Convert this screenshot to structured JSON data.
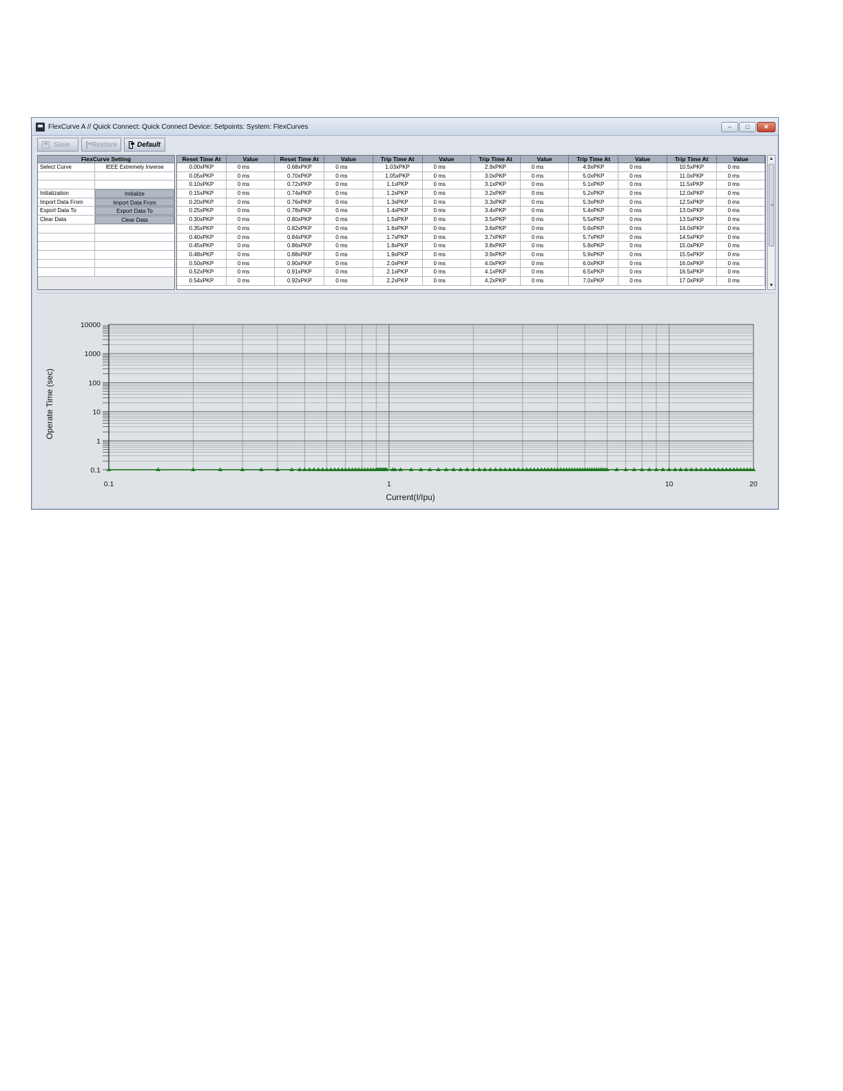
{
  "window": {
    "title": "FlexCurve A // Quick Connect: Quick Connect Device: Setpoints: System: FlexCurves",
    "controls": {
      "minimize": "–",
      "maximize": "□",
      "close": "✕"
    }
  },
  "toolbar": {
    "save_label": "Save",
    "restore_label": "Restore",
    "default_label": "Default"
  },
  "settings_panel": {
    "header": "FlexCurve Setting",
    "rows": [
      {
        "label": "Select Curve",
        "value": "IEEE Extremely Inverse",
        "is_button": false
      },
      {
        "label": "",
        "value": "",
        "is_button": false
      },
      {
        "label": "",
        "value": "",
        "is_button": false
      },
      {
        "label": "Initialization",
        "value": "Initialize",
        "is_button": true
      },
      {
        "label": "Import Data From",
        "value": "Import Data From",
        "is_button": true
      },
      {
        "label": "Export Data To",
        "value": "Export Data To",
        "is_button": true
      },
      {
        "label": "Clear Data",
        "value": "Clear Data",
        "is_button": true
      },
      {
        "label": "",
        "value": "",
        "is_button": false
      },
      {
        "label": "",
        "value": "",
        "is_button": false
      },
      {
        "label": "",
        "value": "",
        "is_button": false
      },
      {
        "label": "",
        "value": "",
        "is_button": false
      },
      {
        "label": "",
        "value": "",
        "is_button": false
      },
      {
        "label": "",
        "value": "",
        "is_button": false
      }
    ]
  },
  "curve_table": {
    "headers": [
      "Reset Time At",
      "Value",
      "Reset Time At",
      "Value",
      "Trip Time At",
      "Value",
      "Trip Time At",
      "Value",
      "Trip Time At",
      "Value",
      "Trip Time At",
      "Value"
    ],
    "columns": [
      [
        "0.00xPKP",
        "0.05xPKP",
        "0.10xPKP",
        "0.15xPKP",
        "0.20xPKP",
        "0.25xPKP",
        "0.30xPKP",
        "0.35xPKP",
        "0.40xPKP",
        "0.45xPKP",
        "0.48xPKP",
        "0.50xPKP",
        "0.52xPKP",
        "0.54xPKP"
      ],
      [
        "0.68xPKP",
        "0.70xPKP",
        "0.72xPKP",
        "0.74xPKP",
        "0.76xPKP",
        "0.78xPKP",
        "0.80xPKP",
        "0.82xPKP",
        "0.84xPKP",
        "0.86xPKP",
        "0.88xPKP",
        "0.90xPKP",
        "0.91xPKP",
        "0.92xPKP"
      ],
      [
        "1.03xPKP",
        "1.05xPKP",
        "1.1xPKP",
        "1.2xPKP",
        "1.3xPKP",
        "1.4xPKP",
        "1.5xPKP",
        "1.6xPKP",
        "1.7xPKP",
        "1.8xPKP",
        "1.9xPKP",
        "2.0xPKP",
        "2.1xPKP",
        "2.2xPKP"
      ],
      [
        "2.9xPKP",
        "3.0xPKP",
        "3.1xPKP",
        "3.2xPKP",
        "3.3xPKP",
        "3.4xPKP",
        "3.5xPKP",
        "3.6xPKP",
        "3.7xPKP",
        "3.8xPKP",
        "3.9xPKP",
        "4.0xPKP",
        "4.1xPKP",
        "4.2xPKP"
      ],
      [
        "4.9xPKP",
        "5.0xPKP",
        "5.1xPKP",
        "5.2xPKP",
        "5.3xPKP",
        "5.4xPKP",
        "5.5xPKP",
        "5.6xPKP",
        "5.7xPKP",
        "5.8xPKP",
        "5.9xPKP",
        "6.0xPKP",
        "6.5xPKP",
        "7.0xPKP"
      ],
      [
        "10.5xPKP",
        "11.0xPKP",
        "11.5xPKP",
        "12.0xPKP",
        "12.5xPKP",
        "13.0xPKP",
        "13.5xPKP",
        "14.0xPKP",
        "14.5xPKP",
        "15.0xPKP",
        "15.5xPKP",
        "16.0xPKP",
        "16.5xPKP",
        "17.0xPKP"
      ]
    ],
    "value_text": "0 ms"
  },
  "scrollbar": {
    "up": "▲",
    "down": "▼",
    "grip": "≡"
  },
  "chart_data": {
    "type": "scatter",
    "xlabel": "Current(I/Ipu)",
    "ylabel": "Operate Time (sec)",
    "x_scale": "log",
    "y_scale": "log",
    "xlim": [
      0.1,
      20
    ],
    "ylim": [
      0.1,
      10000
    ],
    "x_tick_labels": [
      "0.1",
      "1",
      "10",
      "20"
    ],
    "y_tick_labels": [
      "0.1",
      "1",
      "10",
      "100",
      "1000",
      "10000"
    ],
    "grid": true,
    "line_color": "#1a7a1a",
    "series": [
      {
        "x": [
          0.1,
          0.15,
          0.2,
          0.25,
          0.3,
          0.35,
          0.4,
          0.45,
          0.48,
          0.5,
          0.52,
          0.54,
          0.56,
          0.58,
          0.6,
          0.62,
          0.64,
          0.66,
          0.68,
          0.7,
          0.72,
          0.74,
          0.76,
          0.78,
          0.8,
          0.82,
          0.84,
          0.86,
          0.88,
          0.9,
          0.91,
          0.92,
          0.93,
          0.94,
          0.95,
          0.96,
          0.97,
          0.98,
          1.03,
          1.05,
          1.1,
          1.2,
          1.3,
          1.4,
          1.5,
          1.6,
          1.7,
          1.8,
          1.9,
          2.0,
          2.1,
          2.2,
          2.3,
          2.4,
          2.5,
          2.6,
          2.7,
          2.8,
          2.9,
          3.0,
          3.1,
          3.2,
          3.3,
          3.4,
          3.5,
          3.6,
          3.7,
          3.8,
          3.9,
          4.0,
          4.1,
          4.2,
          4.3,
          4.4,
          4.5,
          4.6,
          4.7,
          4.8,
          4.9,
          5.0,
          5.1,
          5.2,
          5.3,
          5.4,
          5.5,
          5.6,
          5.7,
          5.8,
          5.9,
          6.0,
          6.5,
          7.0,
          7.5,
          8.0,
          8.5,
          9.0,
          9.5,
          10.0,
          10.5,
          11.0,
          11.5,
          12.0,
          12.5,
          13.0,
          13.5,
          14.0,
          14.5,
          15.0,
          15.5,
          16.0,
          16.5,
          17.0,
          17.5,
          18.0,
          18.5,
          19.0,
          19.5,
          20.0
        ],
        "y_constant": 0.1
      }
    ]
  }
}
